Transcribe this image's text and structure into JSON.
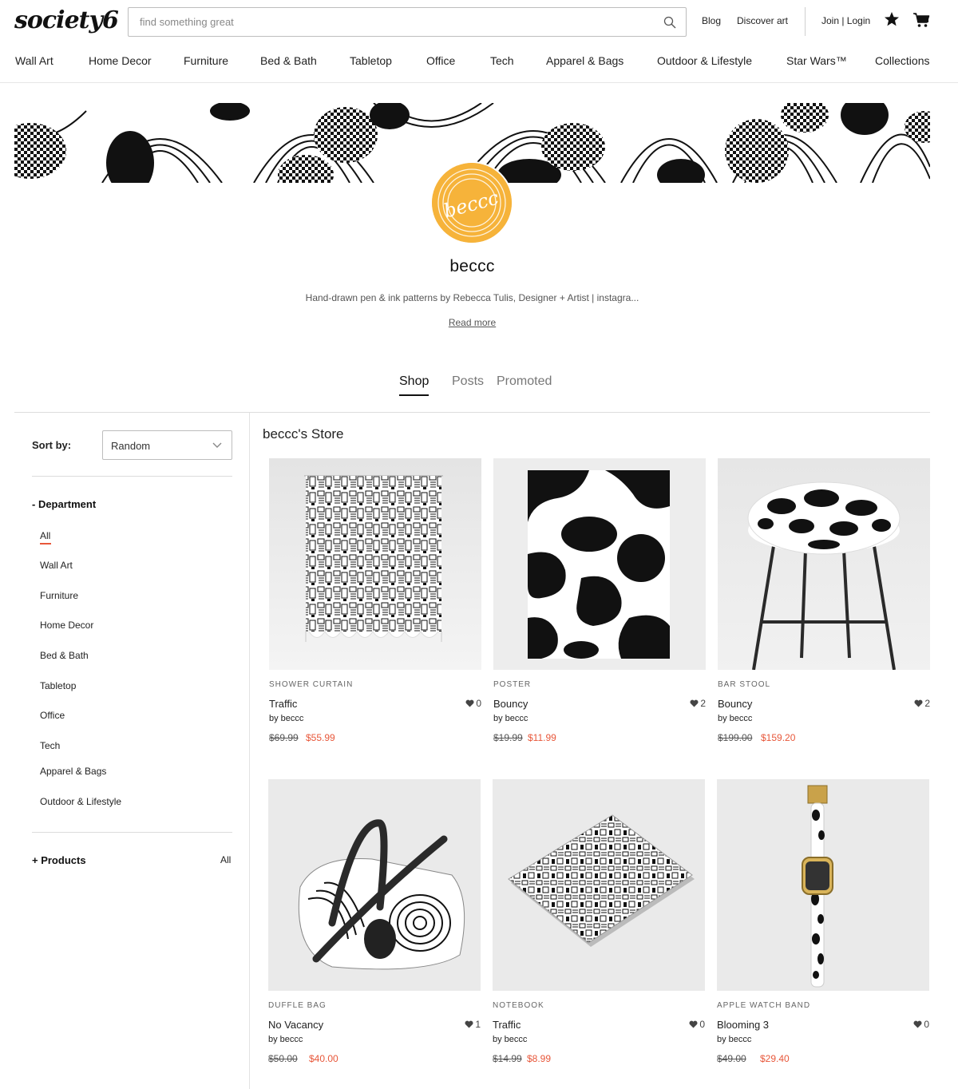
{
  "header": {
    "logo": "society6",
    "search_placeholder": "find something great",
    "links": {
      "blog": "Blog",
      "discover": "Discover art",
      "join": "Join | Login"
    }
  },
  "nav": [
    "Wall Art",
    "Home Decor",
    "Furniture",
    "Bed & Bath",
    "Tabletop",
    "Office",
    "Tech",
    "Apparel & Bags",
    "Outdoor & Lifestyle",
    "Star Wars™",
    "Collections"
  ],
  "profile": {
    "name": "beccc",
    "avatar_text": "beccc",
    "bio": "Hand-drawn pen & ink patterns by Rebecca Tulis, Designer + Artist | instagra...",
    "read_more": "Read more"
  },
  "tabs": [
    "Shop",
    "Posts",
    "Promoted"
  ],
  "active_tab": "Shop",
  "sidebar": {
    "sort_label": "Sort by:",
    "sort_value": "Random",
    "department_title": "- Department",
    "departments": [
      "All",
      "Wall Art",
      "Furniture",
      "Home Decor",
      "Bed & Bath",
      "Tabletop",
      "Office",
      "Tech",
      "Apparel & Bags",
      "Outdoor & Lifestyle"
    ],
    "active_department": "All",
    "products_title": "+ Products",
    "products_value": "All"
  },
  "store_title": "beccc's Store",
  "products": [
    {
      "type": "SHOWER CURTAIN",
      "title": "Traffic",
      "likes": "0",
      "by": "by beccc",
      "price_old": "$69.99",
      "price_new": "$55.99"
    },
    {
      "type": "POSTER",
      "title": "Bouncy",
      "likes": "2",
      "by": "by beccc",
      "price_old": "$19.99",
      "price_new": "$11.99"
    },
    {
      "type": "BAR STOOL",
      "title": "Bouncy",
      "likes": "2",
      "by": "by beccc",
      "price_old": "$199.00",
      "price_new": "$159.20"
    },
    {
      "type": "DUFFLE BAG",
      "title": "No Vacancy",
      "likes": "1",
      "by": "by beccc",
      "price_old": "$50.00",
      "price_new": "$40.00"
    },
    {
      "type": "NOTEBOOK",
      "title": "Traffic",
      "likes": "0",
      "by": "by beccc",
      "price_old": "$14.99",
      "price_new": "$8.99"
    },
    {
      "type": "APPLE WATCH BAND",
      "title": "Blooming 3",
      "likes": "0",
      "by": "by beccc",
      "price_old": "$49.00",
      "price_new": "$29.40"
    }
  ],
  "colors": {
    "accent": "#e8573a",
    "avatar": "#f6b33a"
  }
}
